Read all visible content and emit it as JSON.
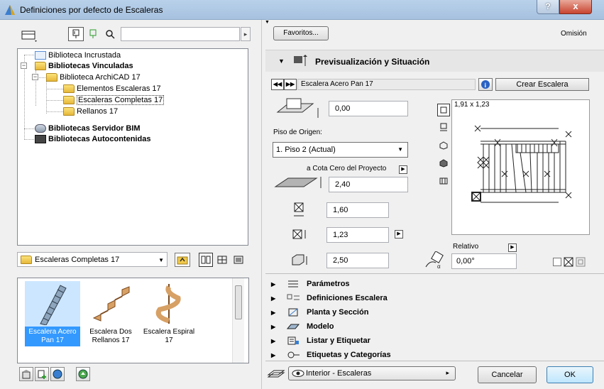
{
  "window": {
    "title": "Definiciones por defecto de Escaleras",
    "help": "?",
    "close": "x"
  },
  "library": {
    "tree": [
      {
        "label": "Biblioteca Incrustada"
      },
      {
        "label": "Bibliotecas Vinculadas"
      },
      {
        "label": "Biblioteca ArchiCAD 17"
      },
      {
        "label": "Elementos Escaleras 17"
      },
      {
        "label": "Escaleras Completas 17"
      },
      {
        "label": "Rellanos 17"
      },
      {
        "label": "Bibliotecas Servidor BIM"
      },
      {
        "label": "Bibliotecas Autocontenidas"
      }
    ],
    "folder_select": "Escaleras Completas 17",
    "items": [
      {
        "label": "Escalera Acero Pan 17"
      },
      {
        "label": "Escalera Dos Rellanos 17"
      },
      {
        "label": "Escalera Espiral 17"
      }
    ]
  },
  "right": {
    "favoritos": "Favoritos...",
    "omision": "Omisión",
    "preview_section": "Previsualización y Situación",
    "object_name": "Escalera Acero Pan 17",
    "create_button": "Crear Escalera",
    "offset": "0,00",
    "piso_label": "Piso de Origen:",
    "piso_value": "1. Piso 2 (Actual)",
    "cota_label": "a Cota Cero del Proyecto",
    "cota_value": "2,40",
    "width_value": "1,60",
    "depth_value": "1,23",
    "height_value": "2,50",
    "preview_size": "1,91 x 1,23",
    "relativo": "Relativo",
    "angle_value": "0,00°",
    "sections": [
      {
        "label": "Parámetros"
      },
      {
        "label": "Definiciones Escalera"
      },
      {
        "label": "Planta y Sección"
      },
      {
        "label": "Modelo"
      },
      {
        "label": "Listar y Etiquetar"
      },
      {
        "label": "Etiquetas y Categorías"
      }
    ],
    "view_select": "Interior - Escaleras",
    "cancel": "Cancelar",
    "ok": "OK"
  }
}
